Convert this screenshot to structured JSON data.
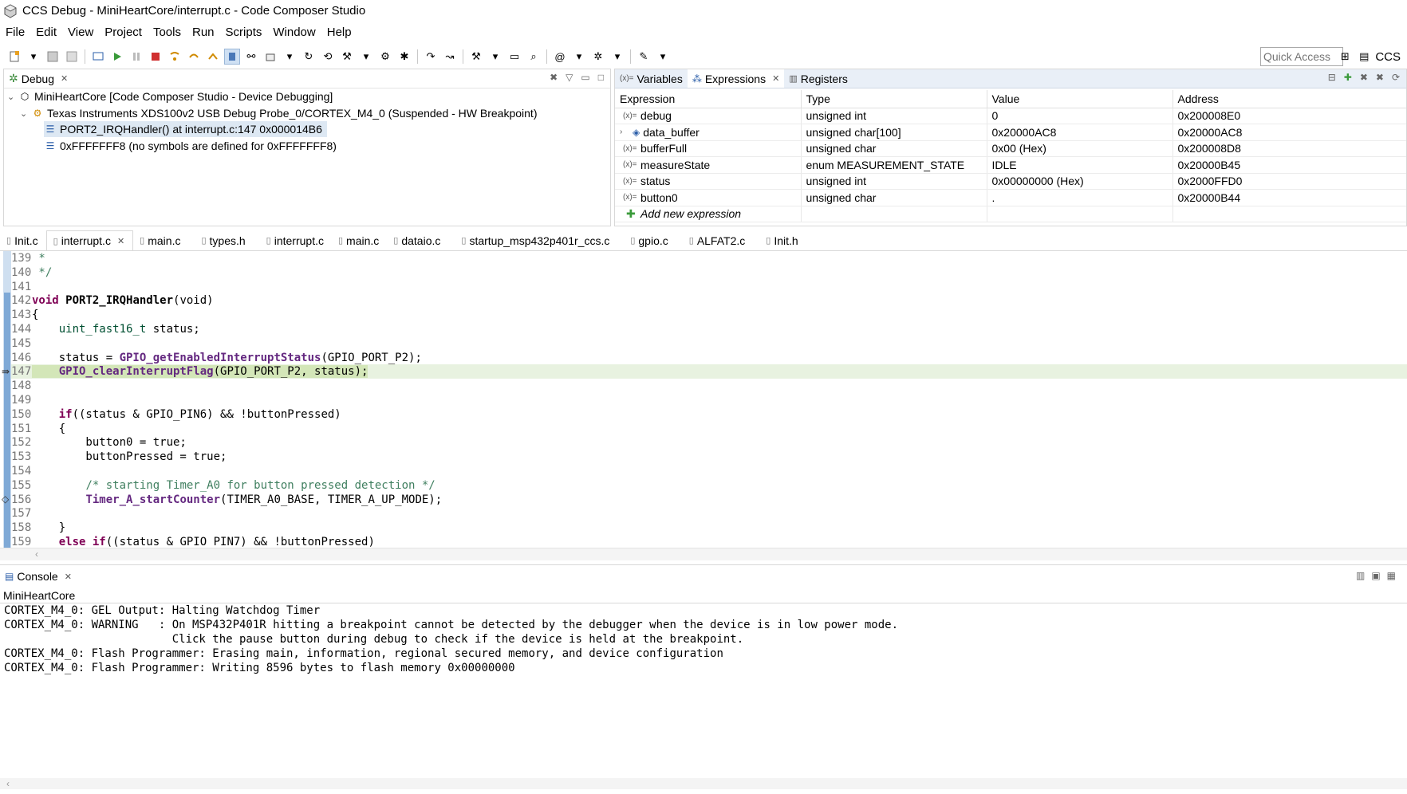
{
  "window": {
    "title": "CCS Debug - MiniHeartCore/interrupt.c - Code Composer Studio"
  },
  "menu": [
    "File",
    "Edit",
    "View",
    "Project",
    "Tools",
    "Run",
    "Scripts",
    "Window",
    "Help"
  ],
  "toolbar": {
    "quick_access_placeholder": "Quick Access",
    "perspective_label": "CCS"
  },
  "debug_view": {
    "tab_label": "Debug",
    "tree": {
      "project": "MiniHeartCore [Code Composer Studio - Device Debugging]",
      "target": "Texas Instruments XDS100v2 USB Debug Probe_0/CORTEX_M4_0 (Suspended - HW Breakpoint)",
      "frame1": "PORT2_IRQHandler() at interrupt.c:147 0x000014B6",
      "frame2": "0xFFFFFFF8  (no symbols are defined for 0xFFFFFFF8)"
    }
  },
  "expressions_view": {
    "tabs": {
      "variables": "Variables",
      "expressions": "Expressions",
      "registers": "Registers"
    },
    "columns": {
      "expression": "Expression",
      "type": "Type",
      "value": "Value",
      "address": "Address"
    },
    "rows": [
      {
        "expression": "debug",
        "type": "unsigned int",
        "value": "0",
        "address": "0x200008E0"
      },
      {
        "expression": "data_buffer",
        "type": "unsigned char[100]",
        "value": "0x20000AC8",
        "address": "0x20000AC8"
      },
      {
        "expression": "bufferFull",
        "type": "unsigned char",
        "value": "0x00 (Hex)",
        "address": "0x200008D8"
      },
      {
        "expression": "measureState",
        "type": "enum MEASUREMENT_STATE",
        "value": "IDLE",
        "address": "0x20000B45"
      },
      {
        "expression": "status",
        "type": "unsigned int",
        "value": "0x00000000 (Hex)",
        "address": "0x2000FFD0"
      },
      {
        "expression": "button0",
        "type": "unsigned char",
        "value": ".",
        "address": "0x20000B44"
      }
    ],
    "add_new": "Add new expression"
  },
  "editor_tabs": [
    "Init.c",
    "interrupt.c",
    "main.c",
    "types.h",
    "interrupt.c",
    "main.c",
    "dataio.c",
    "startup_msp432p401r_ccs.c",
    "gpio.c",
    "ALFAT2.c",
    "Init.h"
  ],
  "code": {
    "l139": {
      "n": "139",
      "t": " *"
    },
    "l140": {
      "n": "140",
      "t": " */"
    },
    "l141": {
      "n": "141",
      "t": ""
    },
    "l142": {
      "n": "142",
      "kw": "void",
      "fn": "PORT2_IRQHandler",
      "rest": "(void)"
    },
    "l143": {
      "n": "143",
      "t": "{"
    },
    "l144": {
      "n": "144",
      "ty": "uint_fast16_t",
      "rest": " status;"
    },
    "l145": {
      "n": "145",
      "t": ""
    },
    "l146": {
      "n": "146",
      "pre": "    status = ",
      "fn": "GPIO_getEnabledInterruptStatus",
      "rest": "(GPIO_PORT_P2);"
    },
    "l147": {
      "n": "147",
      "fn": "GPIO_clearInterruptFlag",
      "rest": "(GPIO_PORT_P2, status);"
    },
    "l148": {
      "n": "148",
      "t": ""
    },
    "l149": {
      "n": "149",
      "t": ""
    },
    "l150": {
      "n": "150",
      "kw": "if",
      "rest": "((status & GPIO_PIN6) && !buttonPressed)"
    },
    "l151": {
      "n": "151",
      "t": "    {"
    },
    "l152": {
      "n": "152",
      "t": "        button0 = true;"
    },
    "l153": {
      "n": "153",
      "t": "        buttonPressed = true;"
    },
    "l154": {
      "n": "154",
      "t": ""
    },
    "l155": {
      "n": "155",
      "cm": "/* starting Timer_A0 for button pressed detection */"
    },
    "l156": {
      "n": "156",
      "fn": "Timer_A_startCounter",
      "rest": "(TIMER_A0_BASE, TIMER_A_UP_MODE);"
    },
    "l157": {
      "n": "157",
      "t": ""
    },
    "l158": {
      "n": "158",
      "t": "    }"
    },
    "l159": {
      "n": "159",
      "kw": "else if",
      "rest": "((status & GPIO_PIN7) && !buttonPressed)"
    }
  },
  "console": {
    "tab_label": "Console",
    "name": "MiniHeartCore",
    "lines": [
      "CORTEX_M4_0: GEL Output: Halting Watchdog Timer",
      "CORTEX_M4_0: WARNING   : On MSP432P401R hitting a breakpoint cannot be detected by the debugger when the device is in low power mode.",
      "                         Click the pause button during debug to check if the device is held at the breakpoint.",
      "CORTEX_M4_0: Flash Programmer: Erasing main, information, regional secured memory, and device configuration",
      "CORTEX_M4_0: Flash Programmer: Writing 8596 bytes to flash memory 0x00000000"
    ]
  }
}
